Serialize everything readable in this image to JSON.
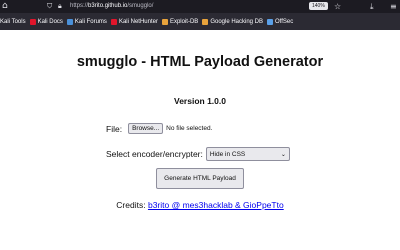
{
  "browser": {
    "url_prefix": "https://",
    "url_host": "b3rito.github.io",
    "url_path": "/smugglo/",
    "zoom": "140%"
  },
  "bookmarks": [
    {
      "label": "Kali Tools",
      "color": "#367bf0"
    },
    {
      "label": "Kali Docs",
      "color": "#e0152b"
    },
    {
      "label": "Kali Forums",
      "color": "#4a90d9"
    },
    {
      "label": "Kali NetHunter",
      "color": "#e0152b"
    },
    {
      "label": "Exploit-DB",
      "color": "#e8a33c"
    },
    {
      "label": "Google Hacking DB",
      "color": "#e8a33c"
    },
    {
      "label": "OffSec",
      "color": "#5aa0e8"
    }
  ],
  "page": {
    "title": "smugglo - HTML Payload Generator",
    "version": "Version 1.0.0",
    "file_label": "File:",
    "browse_label": "Browse...",
    "no_file_text": "No file selected.",
    "select_label": "Select encoder/encrypter:",
    "select_value": "Hide in CSS",
    "generate_label": "Generate HTML Payload",
    "credits_label": "Credits:",
    "credits_link": "b3rito @ mes3hacklab & GioPpeTto"
  }
}
